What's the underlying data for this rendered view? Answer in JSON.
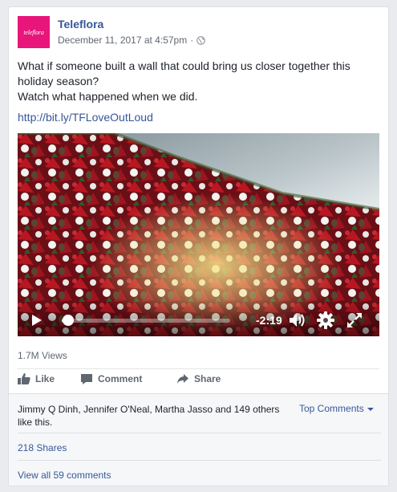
{
  "post": {
    "page_name": "Teleflora",
    "avatar_text": "teleflora",
    "timestamp": "December 11, 2017 at 4:57pm",
    "separator": "·",
    "privacy_icon": "globe-icon",
    "text_lines": [
      "What if someone built a wall that could bring us closer together this",
      "holiday season?",
      "Watch what happened when we did."
    ],
    "link": "http://bit.ly/TFLoveOutLoud"
  },
  "video": {
    "time_remaining": "-2:19",
    "progress": 0.04,
    "play_icon": "play-icon",
    "volume_icon": "volume-icon",
    "settings_icon": "gear-icon",
    "fullscreen_icon": "fullscreen-icon"
  },
  "stats": {
    "views": "1.7M Views"
  },
  "actions": {
    "like": "Like",
    "comment": "Comment",
    "share": "Share"
  },
  "footer": {
    "likes_line1": "Jimmy Q Dinh, Jennifer O'Neal, Martha Jasso and 149 others",
    "likes_line2": "like this.",
    "top_comments": "Top Comments",
    "shares": "218 Shares",
    "view_all": "View all 59 comments"
  },
  "colors": {
    "brand_link": "#365899",
    "avatar_bg": "#e8157b",
    "muted": "#606770",
    "footer_bg": "#f6f7f9"
  }
}
